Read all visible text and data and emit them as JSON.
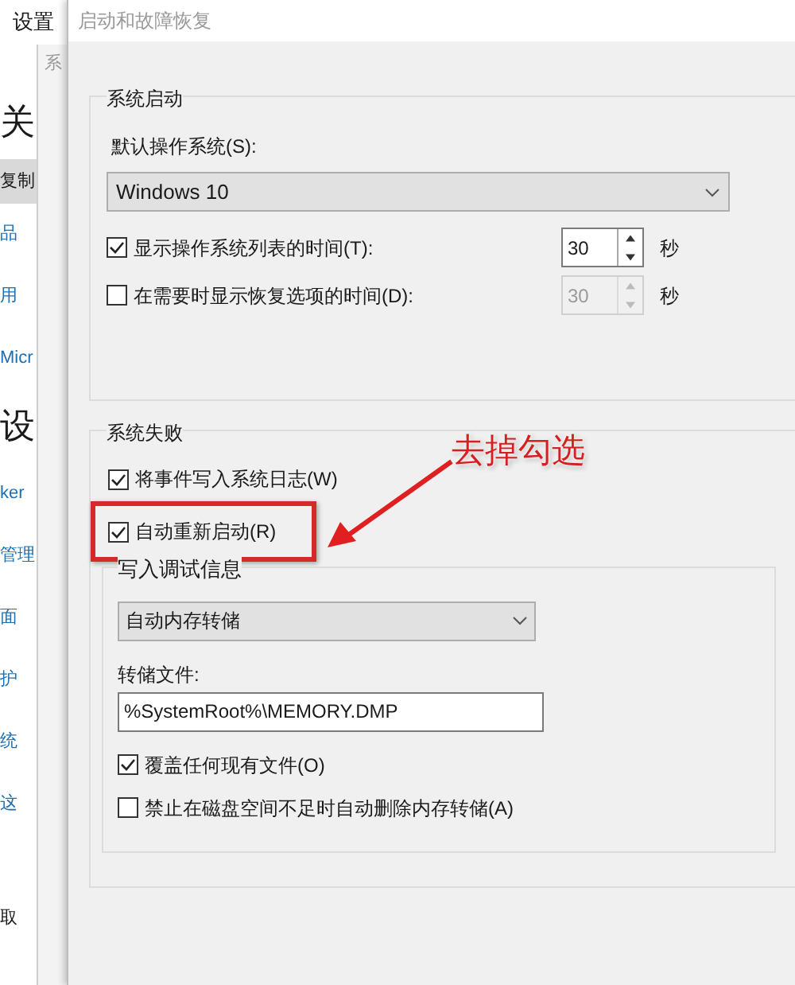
{
  "background_window": {
    "title": "设置",
    "items": [
      {
        "kind": "heading",
        "text": "关"
      },
      {
        "kind": "tab",
        "text": "复制"
      },
      {
        "kind": "link",
        "text": "品"
      },
      {
        "kind": "link",
        "text": "用"
      },
      {
        "kind": "link",
        "text": "Micr"
      },
      {
        "kind": "heading",
        "text": "设"
      },
      {
        "kind": "link",
        "text": "ker"
      },
      {
        "kind": "link",
        "text": "管理"
      },
      {
        "kind": "link",
        "text": "面"
      },
      {
        "kind": "link",
        "text": "护"
      },
      {
        "kind": "link",
        "text": "统"
      },
      {
        "kind": "link",
        "text": "这"
      },
      {
        "kind": "text",
        "text": "取"
      }
    ],
    "middle_window_title": "系"
  },
  "dialog": {
    "title": "启动和故障恢复",
    "system_startup": {
      "title": "系统启动",
      "default_os_label": "默认操作系统(S):",
      "default_os": "Windows 10",
      "timers": [
        {
          "label": "显示操作系统列表的时间(T):",
          "checked": true,
          "value": "30",
          "unit": "秒",
          "disabled": false
        },
        {
          "label": "在需要时显示恢复选项的时间(D):",
          "checked": false,
          "value": "30",
          "unit": "秒",
          "disabled": true
        }
      ]
    },
    "system_failure": {
      "title": "系统失败",
      "options": [
        {
          "label": "将事件写入系统日志(W)",
          "checked": true,
          "highlighted": false
        },
        {
          "label": "自动重新启动(R)",
          "checked": true,
          "highlighted": true
        }
      ],
      "debug": {
        "title": "写入调试信息",
        "dump_type": "自动内存转储",
        "dump_file_label": "转储文件:",
        "dump_file": "%SystemRoot%\\MEMORY.DMP",
        "options": [
          {
            "label": "覆盖任何现有文件(O)",
            "checked": true
          },
          {
            "label": "禁止在磁盘空间不足时自动删除内存转储(A)",
            "checked": false
          }
        ]
      }
    }
  },
  "annotation": {
    "text": "去掉勾选"
  }
}
